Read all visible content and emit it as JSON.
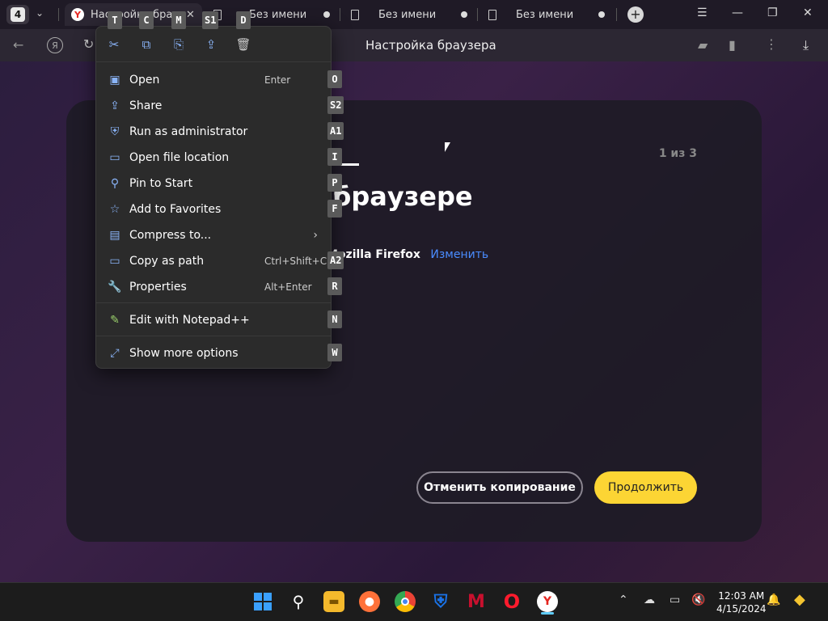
{
  "tabbar": {
    "tab_count": "4",
    "tabs": [
      {
        "label": "Настройка браузера",
        "active": true
      },
      {
        "label": "Без имени"
      },
      {
        "label": "Без имени"
      },
      {
        "label": "Без имени"
      }
    ]
  },
  "addressbar": {
    "title": "Настройка браузера",
    "ya_label": "Я"
  },
  "card": {
    "step": "1 из 3",
    "heading": "браузере",
    "import_browser": "Mozilla Firefox",
    "change_link": "Изменить",
    "cancel_label": "Отменить копирование",
    "continue_label": "Продолжить",
    "continue_color": "#fcd534",
    "link_color": "#4a8cff"
  },
  "context_menu": {
    "toolbar": [
      {
        "icon": "cut-icon",
        "key": "T"
      },
      {
        "icon": "copy-icon",
        "key": "C"
      },
      {
        "icon": "rename-icon",
        "key": "M"
      },
      {
        "icon": "share-icon",
        "key": "S1"
      },
      {
        "icon": "delete-icon",
        "key": "D"
      }
    ],
    "items": [
      {
        "label": "Open",
        "shortcut": "Enter",
        "key": "O",
        "icon": "open-icon"
      },
      {
        "label": "Share",
        "shortcut": "",
        "key": "S2",
        "icon": "share-icon"
      },
      {
        "label": "Run as administrator",
        "shortcut": "",
        "key": "A1",
        "icon": "shield-icon"
      },
      {
        "label": "Open file location",
        "shortcut": "",
        "key": "I",
        "icon": "folder-icon"
      },
      {
        "label": "Pin to Start",
        "shortcut": "",
        "key": "P",
        "icon": "pin-icon"
      },
      {
        "label": "Add to Favorites",
        "shortcut": "",
        "key": "F",
        "icon": "star-icon"
      },
      {
        "label": "Compress to...",
        "shortcut": "",
        "key": "",
        "icon": "archive-icon"
      },
      {
        "label": "Copy as path",
        "shortcut": "Ctrl+Shift+C",
        "key": "A2",
        "icon": "path-icon"
      },
      {
        "label": "Properties",
        "shortcut": "Alt+Enter",
        "key": "R",
        "icon": "wrench-icon"
      },
      {
        "label": "Edit with Notepad++",
        "shortcut": "",
        "key": "N",
        "icon": "notepad-icon"
      },
      {
        "label": "Show more options",
        "shortcut": "",
        "key": "W",
        "icon": "more-options-icon"
      }
    ]
  },
  "taskbar": {
    "time": "12:03 AM",
    "date": "4/15/2024"
  }
}
